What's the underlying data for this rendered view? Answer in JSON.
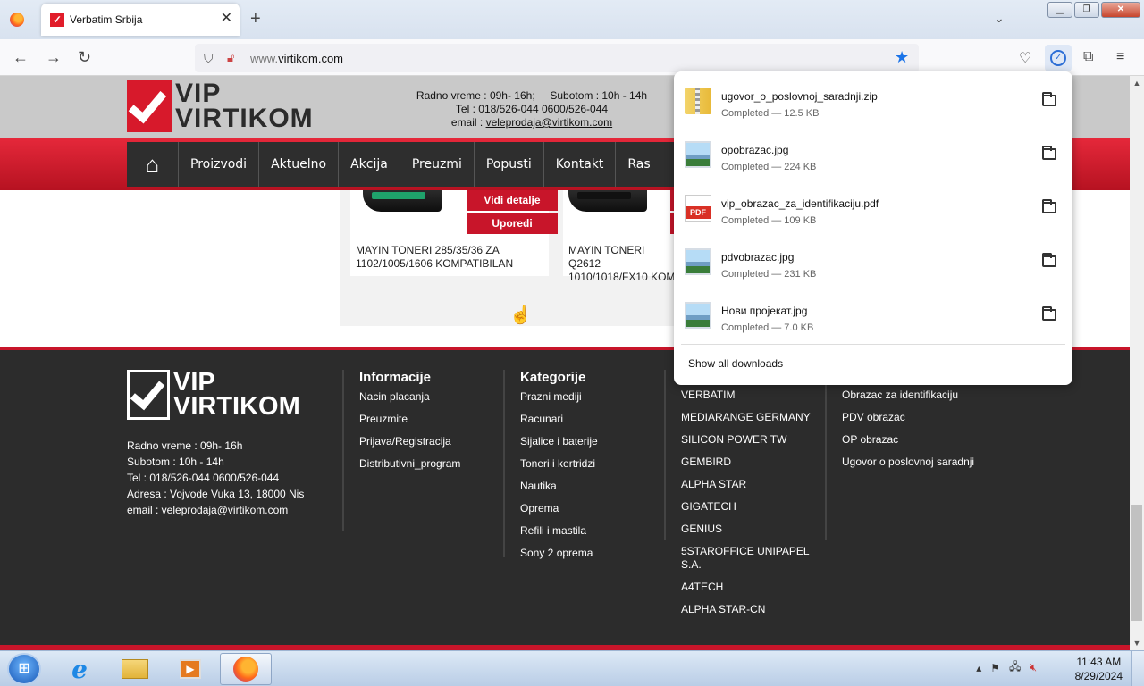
{
  "browser": {
    "tab_title": "Verbatim Srbija",
    "tab_close": "✕",
    "new_tab": "+",
    "url_prefix": "www.",
    "url_domain": "virtikom.com"
  },
  "site": {
    "logo_line1": "VIP",
    "logo_line2": "VIRTIKOM",
    "header": {
      "line1": "Radno vreme : 09h- 16h;     Subotom : 10h - 14h",
      "line2": "Tel : 018/526-044 0600/526-044",
      "email_label": "email : ",
      "email": "veleprodaja@virtikom.com"
    },
    "menu": [
      "Proizvodi",
      "Aktuelno",
      "Akcija",
      "Preuzmi",
      "Popusti",
      "Kontakt",
      "Ras"
    ],
    "products": [
      {
        "name": "MAYIN TONERI 285/35/36 ZA 1102/1005/1606 KOMPATIBILAN",
        "btn_details": "Vidi detalje",
        "btn_compare": "Uporedi"
      },
      {
        "name": "MAYIN TONERI Q2612 1010/1018/FX10 KOM"
      }
    ],
    "footer": {
      "contact": [
        "Radno vreme : 09h- 16h",
        "Subotom : 10h - 14h",
        "Tel : 018/526-044 0600/526-044",
        "Adresa : Vojvode Vuka 13, 18000 Nis",
        "email : veleprodaja@virtikom.com"
      ],
      "info_title": "Informacije",
      "info_items": [
        "Nacin placanja",
        "Preuzmite",
        "Prijava/Registracija",
        "Distributivni_program"
      ],
      "cat_title": "Kategorije",
      "cat_items": [
        "Prazni mediji",
        "Racunari",
        "Sijalice i baterije",
        "Toneri i kertridzi",
        "Nautika",
        "Oprema",
        "Refili i mastila",
        "Sony 2 oprema"
      ],
      "brand_items": [
        "VERBATIM",
        "MEDIARANGE GERMANY",
        "SILICON POWER TW",
        "GEMBIRD",
        "ALPHA STAR",
        "GIGATECH",
        "GENIUS",
        "5STAROFFICE UNIPAPEL S.A.",
        "A4TECH",
        "ALPHA STAR-CN"
      ],
      "doc_items": [
        "Obrazac za identifikaciju",
        "PDV obrazac",
        "OP obrazac",
        "Ugovor o poslovnoj saradnji"
      ]
    }
  },
  "downloads": {
    "items": [
      {
        "name": "ugovor_o_poslovnoj_saradnji.zip",
        "status": "Completed — 12.5 KB",
        "icon": "zip-file-icon"
      },
      {
        "name": "opobrazac.jpg",
        "status": "Completed — 224 KB",
        "icon": "image-file-icon"
      },
      {
        "name": "vip_obrazac_za_identifikaciju.pdf",
        "status": "Completed — 109 KB",
        "icon": "pdf-file-icon"
      },
      {
        "name": "pdvobrazac.jpg",
        "status": "Completed — 231 KB",
        "icon": "image-file-icon"
      },
      {
        "name": "Нови пројекат.jpg",
        "status": "Completed — 7.0 KB",
        "icon": "image-file-icon"
      }
    ],
    "pdf_label": "PDF",
    "show_all": "Show all downloads"
  },
  "taskbar": {
    "time": "11:43 AM",
    "date": "8/29/2024"
  },
  "colors": {
    "brand_red": "#c8152a",
    "menu_dark": "#2e2e2e",
    "footer_dark": "#2c2c2c",
    "accent_blue": "#1a73e8"
  }
}
